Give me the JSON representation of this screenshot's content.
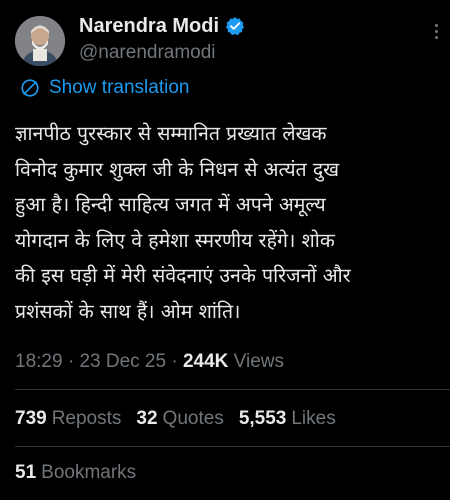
{
  "author": {
    "display_name": "Narendra Modi",
    "handle": "@narendramodi",
    "verified_color": "#1d9bf0",
    "avatar_icon": "profile-photo"
  },
  "translation": {
    "label": "Show translation",
    "color": "#1d9bf0",
    "icon": "globe-icon"
  },
  "tweet": {
    "lines": [
      "ज्ञानपीठ पुरस्कार से सम्मानित प्रख्यात लेखक",
      "विनोद कुमार शुक्ल जी के निधन से अत्यंत दुख",
      "हुआ है। हिन्दी साहित्य जगत में अपने अमूल्य",
      "योगदान के लिए वे हमेशा स्मरणीय रहेंगे। शोक",
      "की इस घड़ी में मेरी संवेदनाएं उनके परिजनों और",
      "प्रशंसकों के साथ हैं। ओम शांति।"
    ]
  },
  "meta": {
    "time": "18:29",
    "separator": " · ",
    "date": "23 Dec 25",
    "views_count": "244K",
    "views_label": " Views"
  },
  "stats": {
    "reposts": {
      "count": "739",
      "label": "Reposts"
    },
    "quotes": {
      "count": "32",
      "label": "Quotes"
    },
    "likes": {
      "count": "5,553",
      "label": "Likes"
    },
    "bookmarks": {
      "count": "51",
      "label": "Bookmarks"
    }
  },
  "colors": {
    "background": "#000000",
    "text": "#e7e9ea",
    "muted": "#71767b",
    "divider": "#2f3336"
  }
}
